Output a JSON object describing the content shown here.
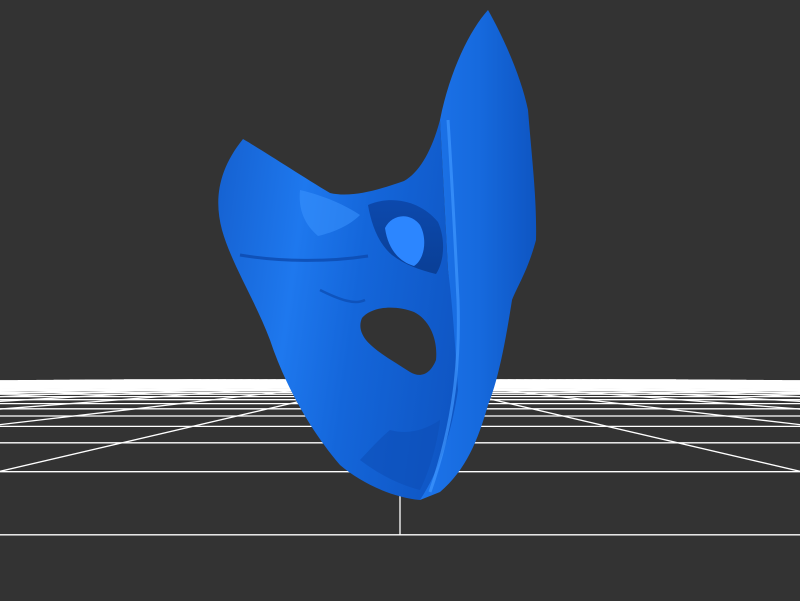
{
  "viewer": {
    "background_color": "#333333",
    "grid_color": "#ffffff",
    "model_color": "#1a6fe0",
    "model_shadow_color": "#0b3f9a",
    "model_highlight_color": "#3d95ff",
    "model_name": "mask-model"
  }
}
